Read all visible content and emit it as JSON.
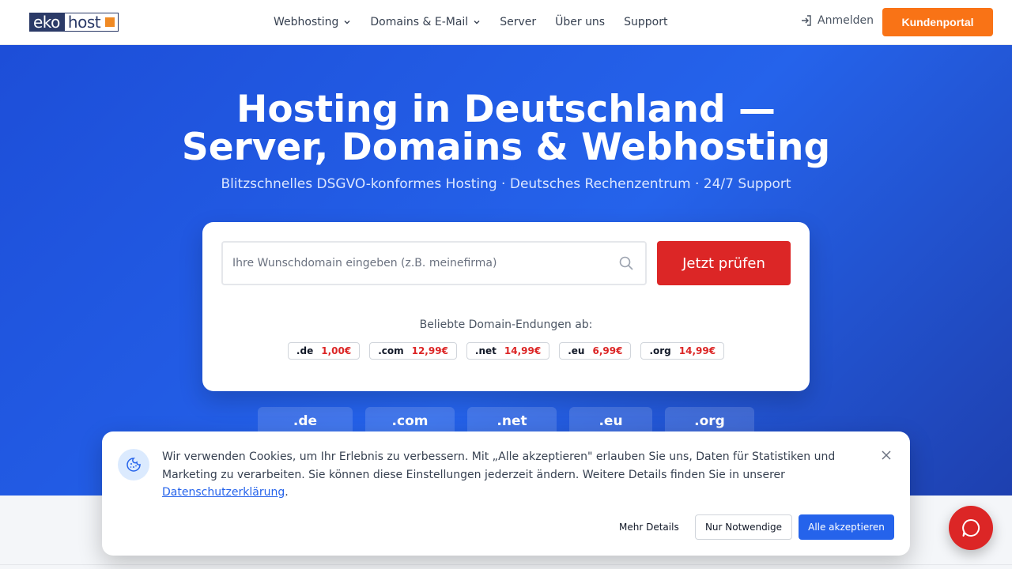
{
  "colors": {
    "brand_blue": "#2563eb",
    "accent_orange": "#f97316",
    "cta_red": "#dc2626",
    "logo_navy": "#2b3a67"
  },
  "header": {
    "logo": {
      "left": "eko",
      "right": "host"
    },
    "nav": [
      {
        "label": "Webhosting",
        "has_dropdown": true,
        "icon": "chevron-down-icon"
      },
      {
        "label": "Domains & E-Mail",
        "has_dropdown": true,
        "icon": "chevron-down-icon"
      },
      {
        "label": "Server",
        "has_dropdown": false
      },
      {
        "label": "Über uns",
        "has_dropdown": false
      },
      {
        "label": "Support",
        "has_dropdown": false
      }
    ],
    "login_label": "Anmelden",
    "portal_label": "Kundenportal"
  },
  "hero": {
    "title_line1": "Hosting in Deutschland —",
    "title_line2": "Server, Domains & Webhosting",
    "subtitle": "Blitzschnelles DSGVO-konformes Hosting · Deutsches Rechenzentrum · 24/7 Support"
  },
  "search": {
    "placeholder": "Ihre Wunschdomain eingeben (z.B. meinefirma)",
    "value": "",
    "button_label": "Jetzt prüfen",
    "popular_label": "Beliebte Domain-Endungen ab:",
    "tlds": [
      {
        "name": ".de",
        "price": "1,00€"
      },
      {
        "name": ".com",
        "price": "12,99€"
      },
      {
        "name": ".net",
        "price": "14,99€"
      },
      {
        "name": ".eu",
        "price": "6,99€"
      },
      {
        "name": ".org",
        "price": "14,99€"
      }
    ]
  },
  "tld_tiles": [
    ".de",
    ".com",
    ".net",
    ".eu",
    ".org"
  ],
  "cookie": {
    "text": "Wir verwenden Cookies, um Ihr Erlebnis zu verbessern. Mit „Alle akzeptieren\" erlauben Sie uns, Daten für Statistiken und Marketing zu verarbeiten. Sie können diese Einstellungen jederzeit ändern. Weitere Details finden Sie in unserer ",
    "link_label": "Datenschutzerklärung",
    "trailing": ".",
    "details_label": "Mehr Details",
    "necessary_label": "Nur Notwendige",
    "accept_label": "Alle akzeptieren"
  }
}
